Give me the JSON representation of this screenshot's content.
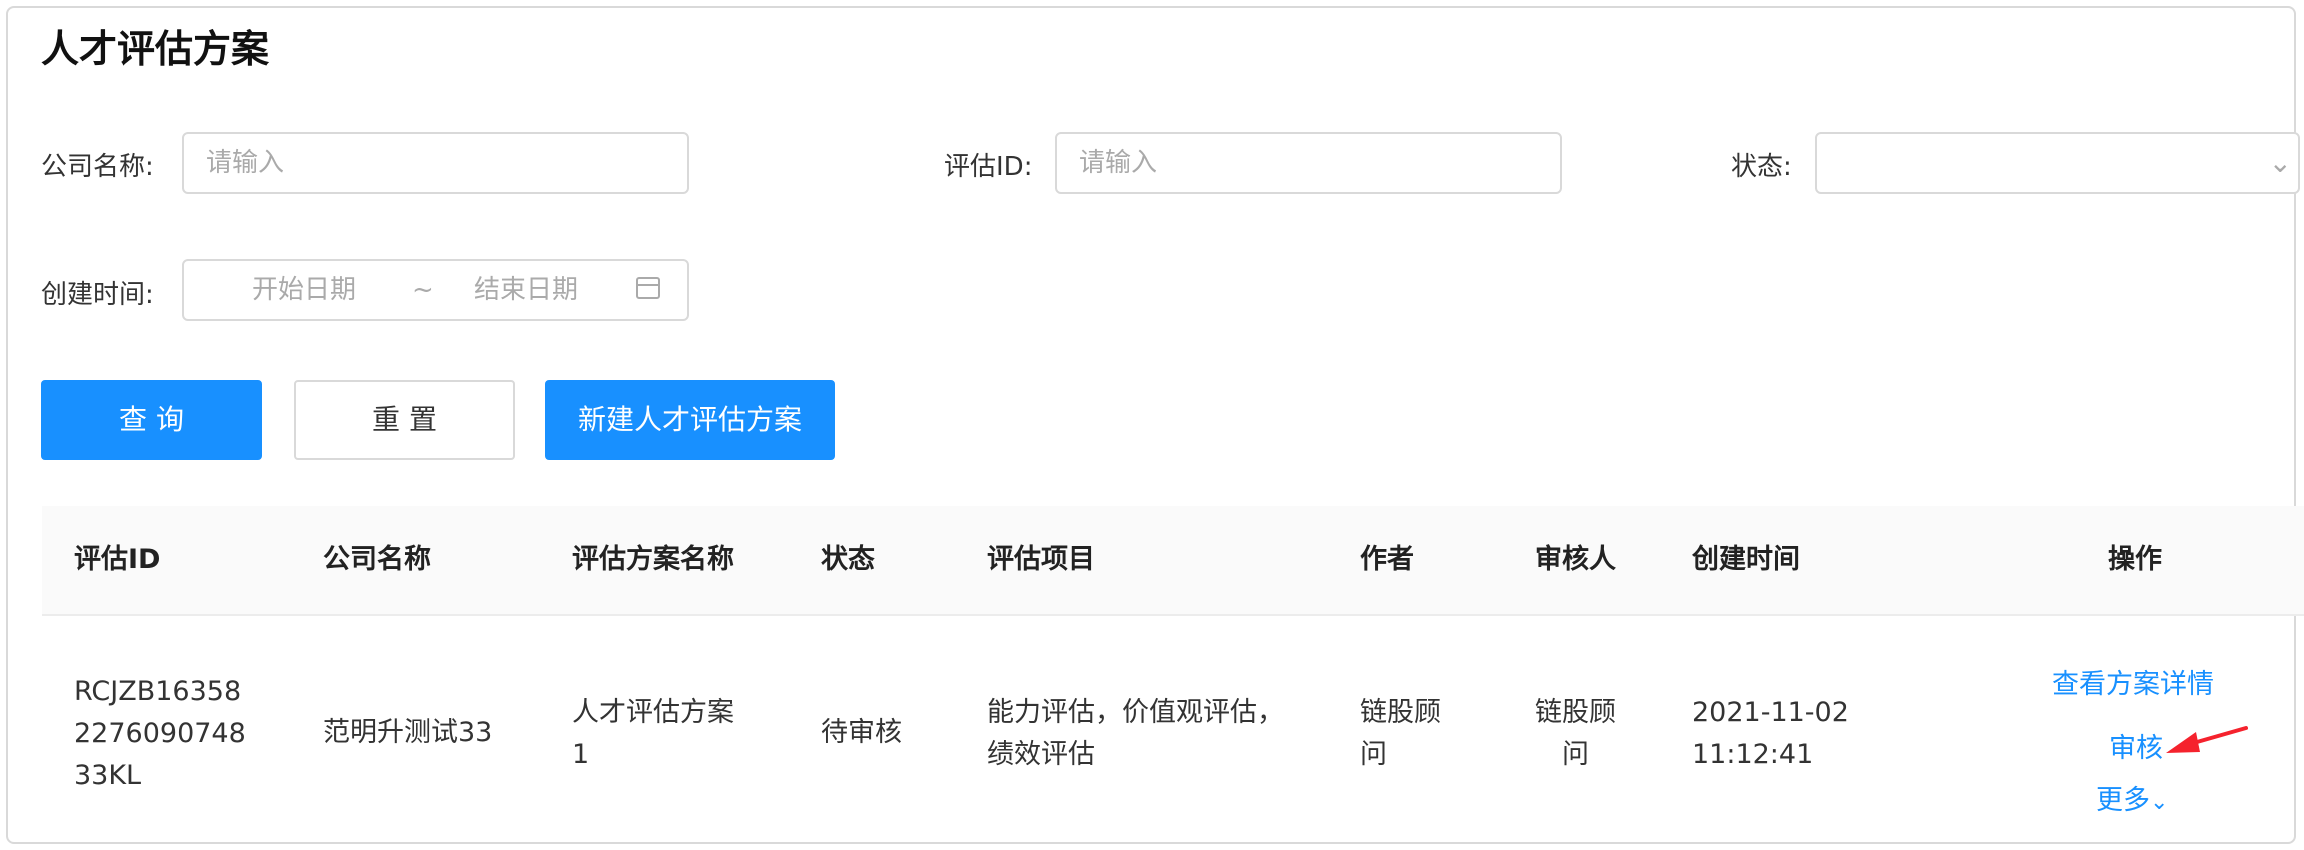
{
  "page": {
    "title": "人才评估方案"
  },
  "filters": {
    "company_label": "公司名称:",
    "company_placeholder": "请输入",
    "eval_id_label": "评估ID:",
    "eval_id_placeholder": "请输入",
    "status_label": "状态:",
    "created_label": "创建时间:",
    "start_placeholder": "开始日期",
    "range_sep": "~",
    "end_placeholder": "结束日期"
  },
  "buttons": {
    "query": "查 询",
    "reset": "重 置",
    "create": "新建人才评估方案"
  },
  "table": {
    "headers": [
      "评估ID",
      "公司名称",
      "评估方案名称",
      "状态",
      "评估项目",
      "作者",
      "审核人",
      "创建时间",
      "操作"
    ],
    "rows": [
      {
        "id_lines": [
          "RCJZB16358",
          "2276090748",
          "33KL"
        ],
        "company": "范明升测试33",
        "plan_lines": [
          "人才评估方案",
          "1"
        ],
        "status": "待审核",
        "items_lines": [
          "能力评估，价值观评估，",
          "绩效评估"
        ],
        "author_lines": [
          "链股顾",
          "问"
        ],
        "reviewer_lines": [
          "链股顾",
          "问"
        ],
        "created_lines": [
          "2021-11-02",
          "11:12:41"
        ],
        "actions": {
          "view": "查看方案详情",
          "review": "审核",
          "more": "更多"
        }
      }
    ]
  },
  "colors": {
    "primary": "#1890ff",
    "annotation_arrow": "#f5222d"
  },
  "icons": [
    "chevron-down-icon",
    "calendar-icon",
    "annotation-arrow"
  ]
}
